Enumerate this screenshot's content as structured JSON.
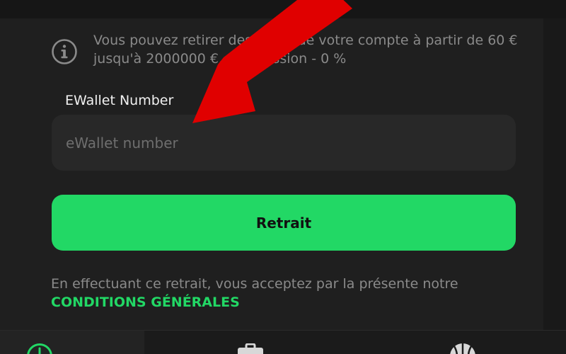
{
  "info": {
    "icon": "info-icon",
    "text": "Vous pouvez retirer des fonds de votre compte à partir de 60 € jusqu'à 2000000 €, commission - 0 %"
  },
  "form": {
    "label": "EWallet Number",
    "placeholder": "eWallet number",
    "value": ""
  },
  "button": {
    "label": "Retrait",
    "color": "#22d865"
  },
  "terms": {
    "text": "En effectuant ce retrait, vous acceptez par la présente notre",
    "link": "CONDITIONS GÉNÉRALES"
  },
  "bottom_nav": {
    "items": [
      {
        "icon": "withdraw-icon",
        "active": true
      },
      {
        "icon": "briefcase-icon",
        "active": false
      },
      {
        "icon": "basketball-icon",
        "active": false
      }
    ]
  },
  "colors": {
    "accent": "#22d865",
    "annotation_arrow": "#e00000",
    "panel": "#1f1f1f",
    "input": "#282828"
  }
}
